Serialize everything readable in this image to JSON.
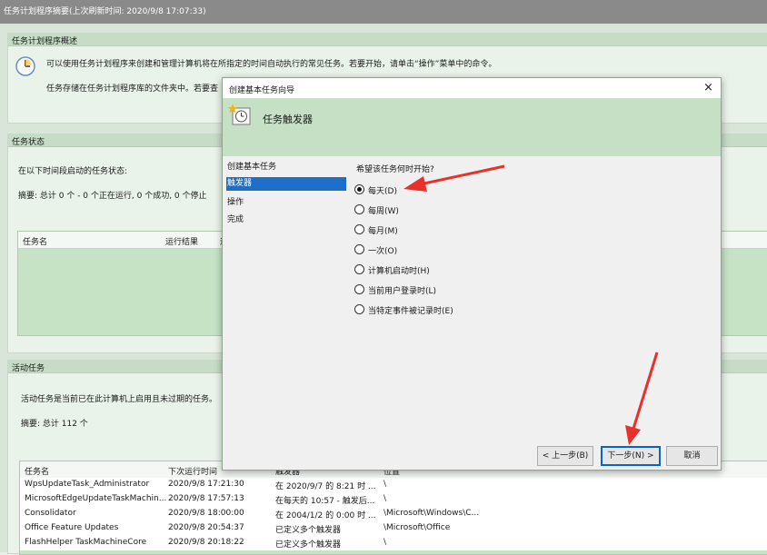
{
  "window": {
    "title": "任务计划程序摘要(上次刷新时间: 2020/9/8 17:07:33)"
  },
  "overview": {
    "header": "任务计划程序概述",
    "line1": "可以使用任务计划程序来创建和管理计算机将在所指定的时间自动执行的常见任务。若要开始，请单击“操作”菜单中的命令。",
    "line2": "任务存储在任务计划程序库的文件夹中。若要查"
  },
  "task_status": {
    "header": "任务状态",
    "label": "在以下时间段启动的任务状态:",
    "summary": "摘要: 总计 0 个 - 0 个正在运行, 0 个成功, 0 个停止",
    "columns": [
      "任务名",
      "运行结果",
      "运"
    ]
  },
  "active_tasks": {
    "header": "活动任务",
    "desc": "活动任务是当前已在此计算机上启用且未过期的任务。",
    "summary": "摘要: 总计 112 个",
    "columns": [
      "任务名",
      "下次运行时间",
      "触发器",
      "位置"
    ],
    "rows": [
      [
        "WpsUpdateTask_Administrator",
        "2020/9/8 17:21:30",
        "在 2020/9/7 的 8:21 时 ...",
        "\\"
      ],
      [
        "MicrosoftEdgeUpdateTaskMachin...",
        "2020/9/8 17:57:13",
        "在每天的 10:57 - 触发后...",
        "\\"
      ],
      [
        "Consolidator",
        "2020/9/8 18:00:00",
        "在 2004/1/2 的 0:00 时 ...",
        "\\Microsoft\\Windows\\C..."
      ],
      [
        "Office Feature Updates",
        "2020/9/8 20:54:37",
        "已定义多个触发器",
        "\\Microsoft\\Office"
      ],
      [
        "FlashHelper TaskMachineCore",
        "2020/9/8 20:18:22",
        "已定义多个触发器",
        "\\"
      ]
    ]
  },
  "dialog": {
    "title": "创建基本任务向导",
    "close": "×",
    "heading": "任务触发器",
    "nav": [
      "创建基本任务",
      "触发器",
      "操作",
      "完成"
    ],
    "nav_selected": 1,
    "question": "希望该任务何时开始?",
    "options": [
      "每天(D)",
      "每周(W)",
      "每月(M)",
      "一次(O)",
      "计算机启动时(H)",
      "当前用户登录时(L)",
      "当特定事件被记录时(E)"
    ],
    "selected_option": 0,
    "buttons": {
      "back": "< 上一步(B)",
      "next": "下一步(N) >",
      "cancel": "取消"
    }
  },
  "colors": {
    "accent": "#1f6fc9",
    "arrow": "#e8312a",
    "panel_green": "#c6e3c6"
  }
}
